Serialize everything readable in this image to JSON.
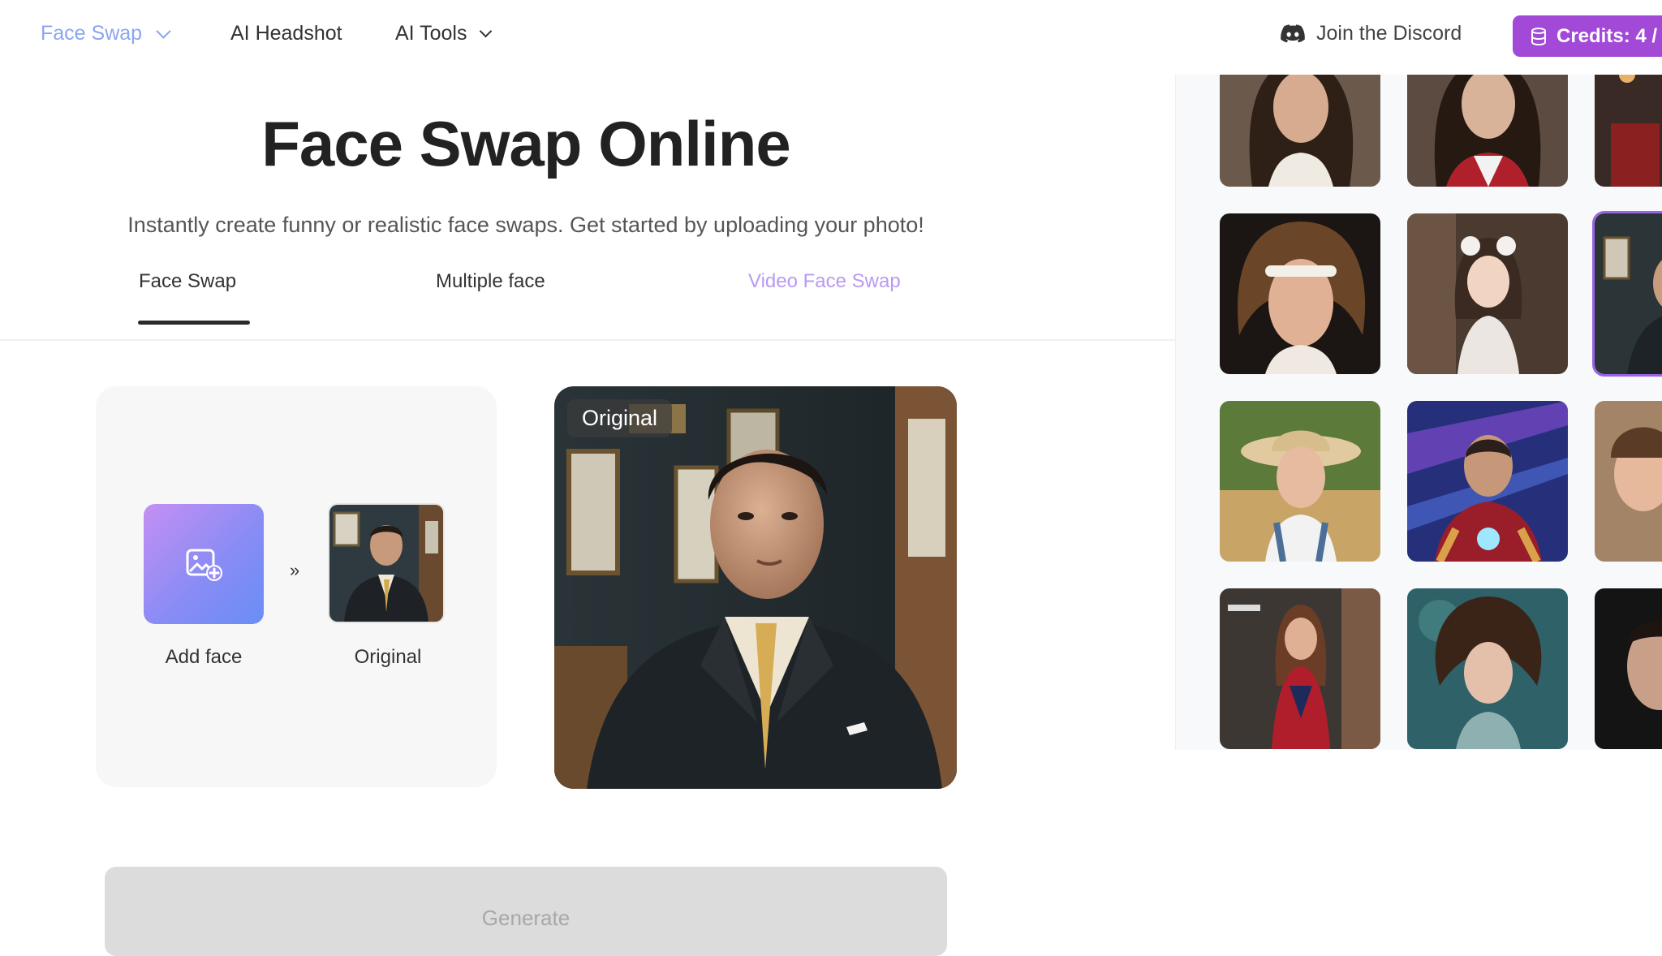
{
  "nav": {
    "face_swap": "Face Swap",
    "ai_headshot": "AI Headshot",
    "ai_tools": "AI Tools",
    "discord": "Join the Discord",
    "credits": "Credits: 4 /"
  },
  "hero": {
    "title": "Face Swap Online",
    "subtitle": "Instantly create funny or realistic face swaps. Get started by uploading your photo!"
  },
  "tabs": {
    "face_swap": "Face Swap",
    "multiple_face": "Multiple face",
    "video_face_swap": "Video Face Swap"
  },
  "workspace": {
    "add_face_label": "Add face",
    "arrows": "»",
    "original_label": "Original",
    "preview_badge": "Original"
  },
  "generate_label": "Generate",
  "colors": {
    "brand_purple": "#a349d8",
    "active_nav": "#8aa6f2",
    "video_tab": "#b89af2"
  },
  "icons": {
    "discord": "discord-icon",
    "credits": "coin-stack-icon",
    "add_face": "add-image-icon"
  }
}
